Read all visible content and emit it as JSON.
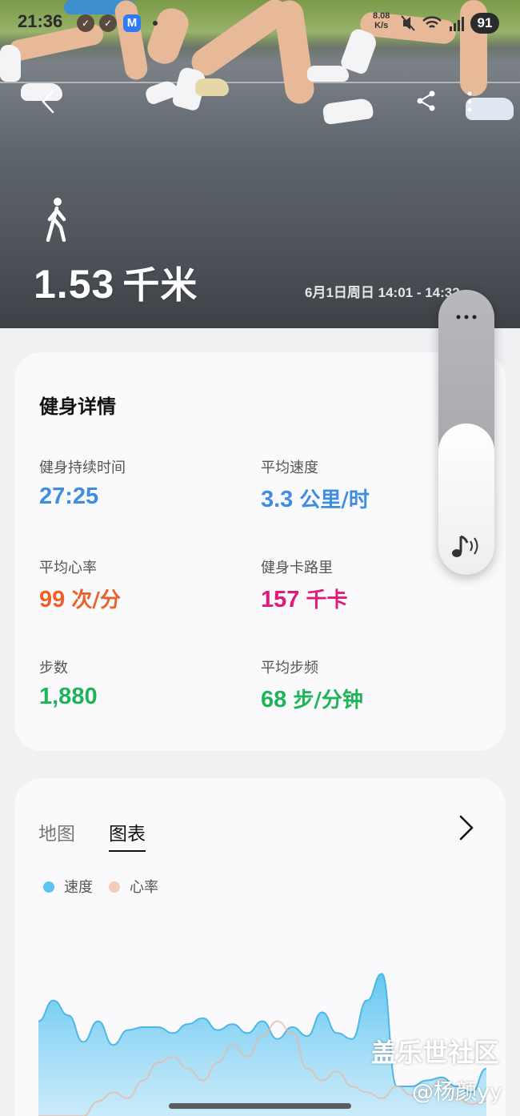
{
  "status_bar": {
    "time": "21:36",
    "net_speed_value": "8.08",
    "net_speed_unit": "K/s",
    "battery": "91",
    "app_icon_letter": "M"
  },
  "hero": {
    "distance_value": "1.53",
    "distance_unit": "千米",
    "datetime": "6月1日周日 14:01 - 14:32",
    "icons": [
      "back-icon",
      "share-icon",
      "more-icon",
      "walking-icon"
    ]
  },
  "details": {
    "title": "健身详情",
    "metrics": [
      {
        "label": "健身持续时间",
        "value": "27:25",
        "unit": "",
        "color": "#3f8de0"
      },
      {
        "label": "平均速度",
        "value": "3.3 ",
        "unit": "公里/时",
        "color": "#3f8de0"
      },
      {
        "label": "平均心率",
        "value": "99 ",
        "unit": "次/分",
        "color": "#e8632a"
      },
      {
        "label": "健身卡路里",
        "value": "157 ",
        "unit": "千卡",
        "color": "#e0197a"
      },
      {
        "label": "步数",
        "value": "1,880",
        "unit": "",
        "color": "#1fb45a"
      },
      {
        "label": "平均步频",
        "value": "68 ",
        "unit": "步/分钟",
        "color": "#1fb45a"
      }
    ]
  },
  "chart_card": {
    "tabs": [
      "地图",
      "图表"
    ],
    "active_tab": "图表",
    "legend": [
      {
        "name": "速度",
        "color": "#5bc4ef"
      },
      {
        "name": "心率",
        "color": "#f6cbb8"
      }
    ]
  },
  "chart_data": {
    "type": "area",
    "series": [
      {
        "name": "速度",
        "values": [
          3.2,
          3.9,
          3.4,
          2.5,
          3.2,
          2.4,
          2.9,
          3.0,
          3.0,
          2.8,
          3.1,
          3.3,
          2.9,
          3.1,
          2.8,
          3.2,
          2.6,
          3.0,
          2.7,
          3.5,
          2.8,
          2.6,
          3.9,
          4.8,
          1.0,
          1.0,
          1.2,
          1.3,
          1.0,
          0.8,
          1.6
        ]
      },
      {
        "name": "心率",
        "values": [
          0,
          0,
          0,
          0,
          0.5,
          0.8,
          0.6,
          1.2,
          1.8,
          2.0,
          1.6,
          1.2,
          1.8,
          2.4,
          2.0,
          2.7,
          3.2,
          2.8,
          1.6,
          1.2,
          1.5,
          1.0,
          0.8,
          0.6,
          1.0,
          0.7,
          0.8,
          1.2,
          0.6,
          0.4,
          0.5
        ]
      }
    ]
  },
  "volume_widget": {
    "level": 0.53
  },
  "watermark": {
    "line1": "盖乐世社区",
    "line2": "@杨颜yy"
  }
}
